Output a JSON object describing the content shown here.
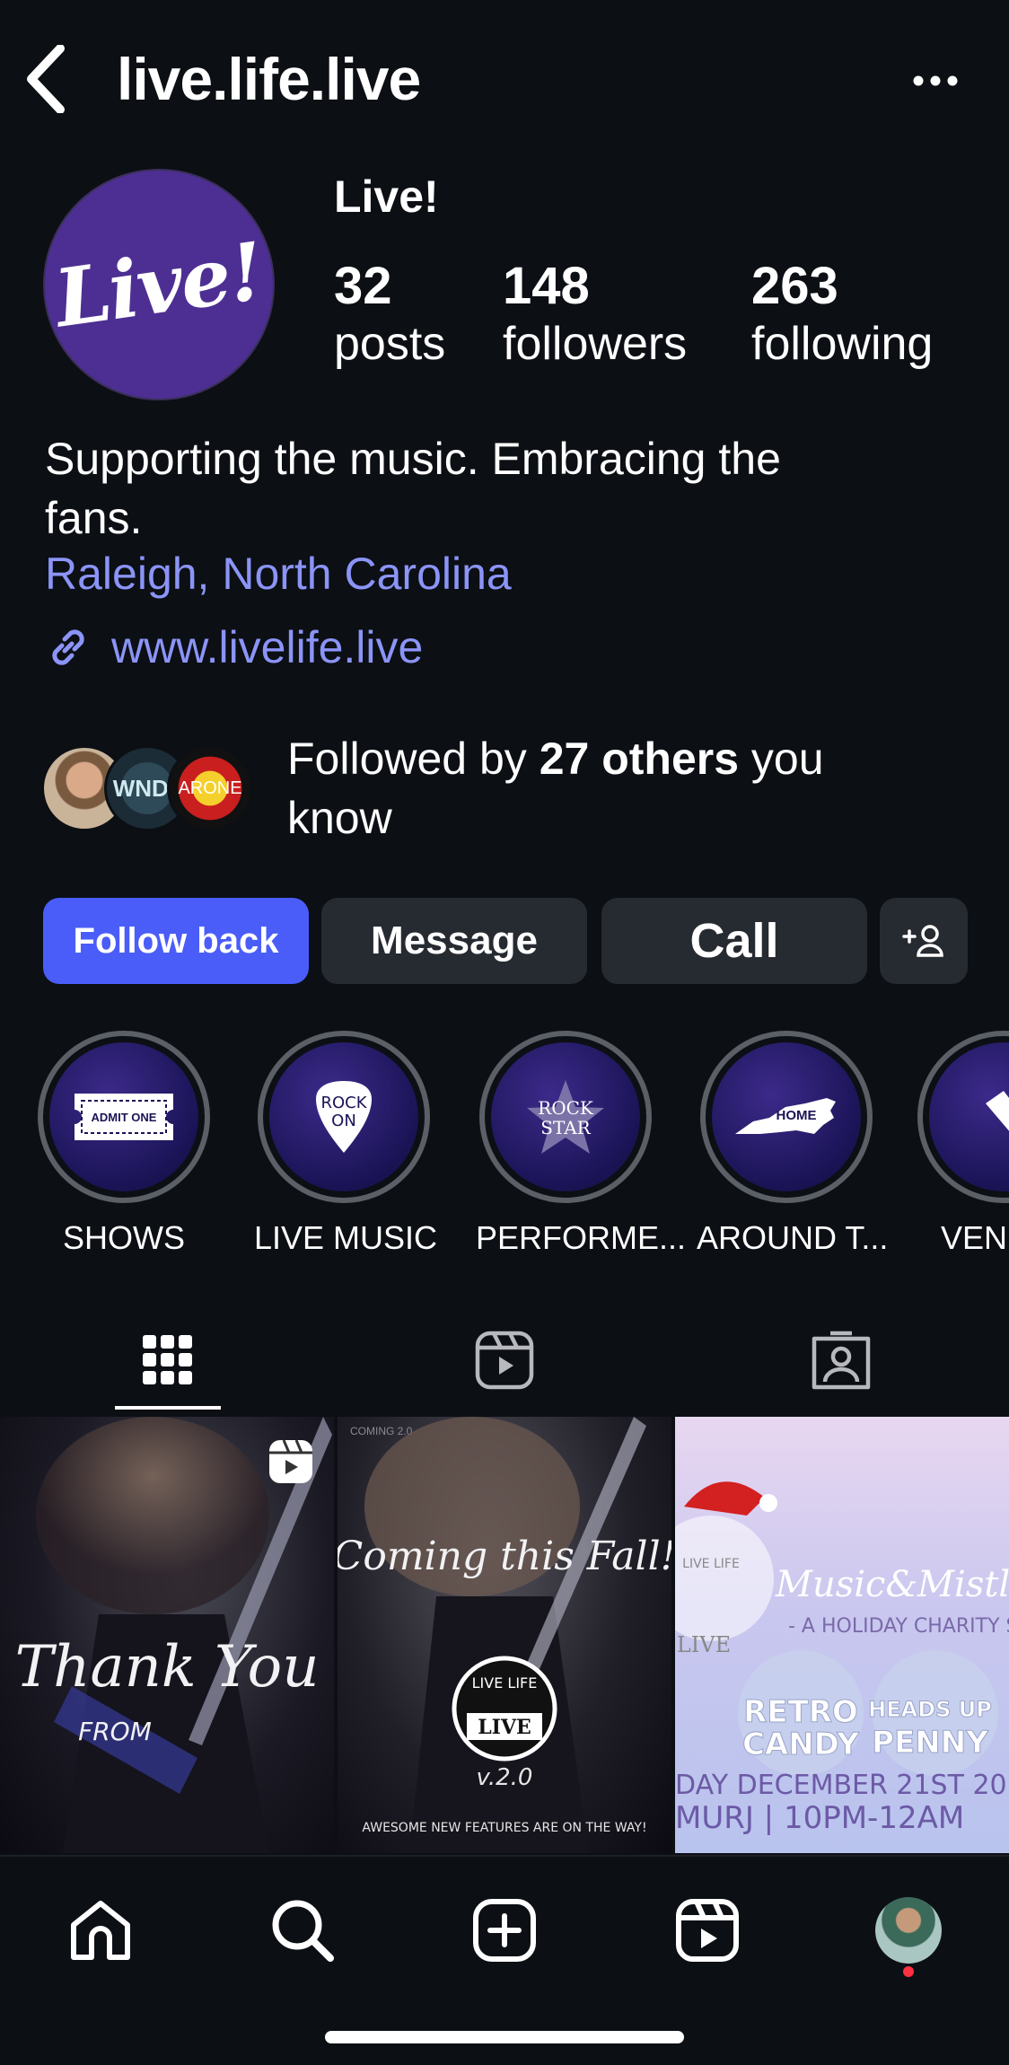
{
  "header": {
    "username": "live.life.live"
  },
  "profile": {
    "display_name": "Live!",
    "avatar_text": "Live!",
    "stats": [
      {
        "value": "32",
        "label": "posts"
      },
      {
        "value": "148",
        "label": "followers"
      },
      {
        "value": "263",
        "label": "following"
      }
    ],
    "bio_line1": "Supporting the music. Embracing the",
    "bio_line2": "fans.",
    "location": "Raleigh, North Carolina",
    "website": "www.livelife.live"
  },
  "mutual": {
    "prefix": "Followed by ",
    "count_text": "27 others",
    "suffix_line1": " you",
    "suffix_line2": "know"
  },
  "actions": {
    "follow_back": "Follow back",
    "message": "Message",
    "call": "Call"
  },
  "highlights": [
    {
      "label": "SHOWS",
      "icon": "ticket-icon",
      "icon_text": "ADMIT ONE"
    },
    {
      "label": "LIVE MUSIC",
      "icon": "guitar-pick-icon",
      "icon_text": "ROCK ON"
    },
    {
      "label": "PERFORME...",
      "icon": "star-icon",
      "icon_text": "ROCK STAR"
    },
    {
      "label": "AROUND T...",
      "icon": "north-carolina-map-icon",
      "icon_text": "HOME"
    },
    {
      "label": "VEN",
      "icon": "venue-icon",
      "icon_text": ""
    }
  ],
  "tabs": [
    "grid-icon",
    "reels-icon",
    "tagged-icon"
  ],
  "posts": [
    {
      "title": "Thank You",
      "subtitle": "FROM",
      "badge": "reel-icon"
    },
    {
      "header": "COMING 2.0",
      "title": "Coming this Fall!",
      "logo_ring": "LIVE LIFE",
      "logo": "LIVE",
      "version": "v.2.0",
      "footer": "AWESOME NEW FEATURES ARE ON THE WAY!"
    },
    {
      "title": "Music&Mistletoe",
      "subtitle": "- A HOLIDAY CHARITY SHOW",
      "ring": "LIVE LIFE",
      "logo": "LIVE",
      "band1_line1": "RETRO",
      "band1_line2": "CANDY",
      "band2_line1": "HEADS UP",
      "band2_line2": "PENNY",
      "date": "DAY DECEMBER 21ST 20",
      "venue": "MURJ | 10PM-12AM"
    }
  ],
  "nav": [
    "home-icon",
    "search-icon",
    "create-icon",
    "reels-icon",
    "profile-avatar"
  ],
  "colors": {
    "background": "#0c0f14",
    "accent": "#4a5df9",
    "link": "#8b94f7",
    "button": "#262a31",
    "avatar_bg": "#4d2f93"
  }
}
